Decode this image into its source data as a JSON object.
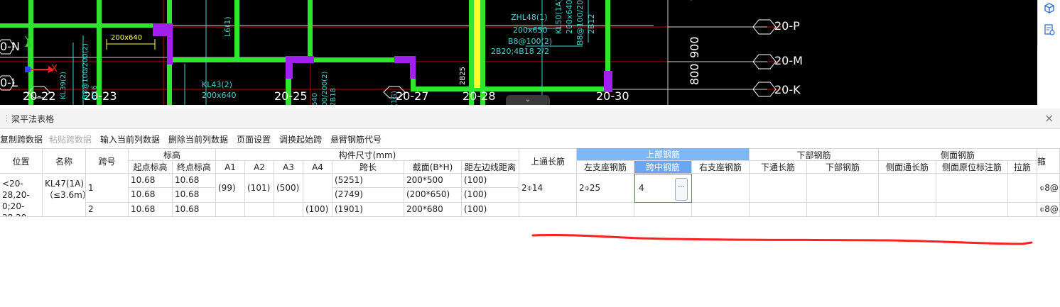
{
  "cad": {
    "axis_labels_left": [
      "0-N",
      "0-L"
    ],
    "axis_labels_right": [
      "20-P",
      "20-M",
      "20-K"
    ],
    "grid_labels_bottom": [
      "20-22",
      "20-23",
      "20-25",
      "20-27",
      "20-28",
      "20-30"
    ],
    "dims_vertical": [
      "16",
      "900",
      "800"
    ],
    "beam_text": {
      "kl43": "KL43(2)",
      "kl43_size": "200x640",
      "l6": "L6(1)",
      "top_size": "200x640",
      "zhl48": "ZHL48(1)",
      "zhl48_size": "200x650",
      "zhl48_stirrup": "B8@100(2)",
      "zhl48_bars": "2B20;4B18 2/2",
      "kl50": "KL50(1A)",
      "kl50_size": "200x640",
      "kl50_stirrup": "B8@100/20",
      "kl50_bars": "2B12",
      "b25": "2B25",
      "kl39": "KL39(2)",
      "kl39_stirrup": "B8@100/200(2)",
      "kl39_b16": "B16",
      "mid_a": "640",
      "mid_b": "00/200(2)",
      "mid_c": "2B18",
      "mid_d": "(1G)"
    },
    "ucs_x": "X",
    "ucs_y": "Y"
  },
  "right_rail": {
    "icons": [
      "cube-icon",
      "list-settings-icon"
    ]
  },
  "panel": {
    "title": "梁平法表格",
    "close": "×"
  },
  "toolbar": {
    "items": [
      {
        "label": "复制跨数据",
        "enabled": true
      },
      {
        "label": "粘贴跨数据",
        "enabled": false
      },
      {
        "label": "输入当前列数据",
        "enabled": true
      },
      {
        "label": "删除当前列数据",
        "enabled": true
      },
      {
        "label": "页面设置",
        "enabled": true
      },
      {
        "label": "调换起始跨",
        "enabled": true
      },
      {
        "label": "悬臂钢筋代号",
        "enabled": true
      }
    ]
  },
  "table": {
    "headers": {
      "position": "位置",
      "name": "名称",
      "span": "跨号",
      "elevation": "标高",
      "elev_start": "起点标高",
      "elev_end": "终点标高",
      "dimension": "构件尺寸(mm)",
      "a1": "A1",
      "a2": "A2",
      "a3": "A3",
      "a4": "A4",
      "span_len": "跨长",
      "section": "截面(B*H)",
      "edge_dist": "距左边线距离",
      "top_through": "上通长筋",
      "top_bars": "上部钢筋",
      "left_seat": "左支座钢筋",
      "mid_span": "跨中钢筋",
      "right_seat": "右支座钢筋",
      "bottom_bars": "下部钢筋",
      "bottom_through": "下通长筋",
      "bottom_bar": "下部钢筋",
      "side_bars": "侧面钢筋",
      "side_through": "侧面通长筋",
      "side_original": "侧面原位标注筋",
      "tie": "拉筋",
      "stirrup": "箍"
    },
    "row1": {
      "position": "<20-28,20-0;20-28,20-X...",
      "name": "KL47(1A)（≤3.6m）",
      "span": "1",
      "elev_start_a": "10.68",
      "elev_end_a": "10.68",
      "elev_start_b": "10.68",
      "elev_end_b": "10.68",
      "a1": "(99)",
      "a2": "(101)",
      "a3": "(500)",
      "span_len_a": "(5251)",
      "span_len_b": "(2749)",
      "section_a": "200*500",
      "section_b": "(200*650)",
      "edge_a": "(100)",
      "edge_b": "(100)",
      "top_through": "2⌽14",
      "left_seat": "2⌽25",
      "mid_span": "4",
      "stirrup": "⌽8@"
    },
    "row2": {
      "span": "2",
      "elev_start": "10.68",
      "elev_end": "10.68",
      "a4": "(100)",
      "span_len": "(1901)",
      "section": "200*680",
      "edge": "(100)",
      "stirrup": "⌽8@"
    },
    "edit_button": "···"
  },
  "colors": {
    "cad_bg": "#000000",
    "beam_green": "#2ee62e",
    "column_purple": "#a020f0",
    "axis_red": "#c00000",
    "cad_cyan": "#3fd3d3",
    "highlight_blue": "#7fb6f7",
    "red_ink": "#ff2020"
  }
}
